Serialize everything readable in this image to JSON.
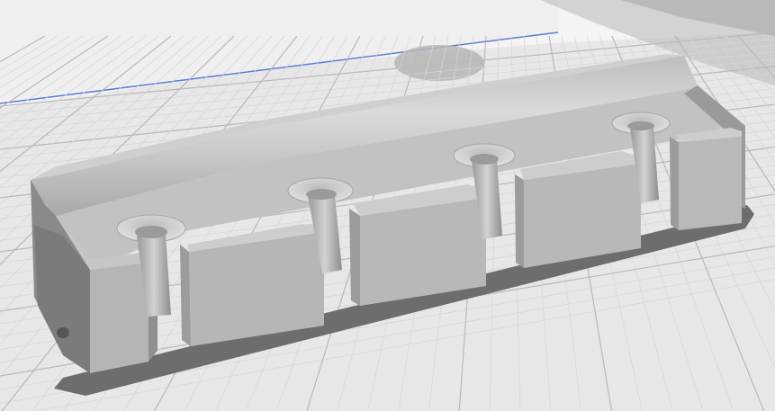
{
  "viewport": {
    "name": "3d-print-preview",
    "model": "bracket-with-countersunk-holes",
    "countersunk_hole_count": 4
  },
  "colors": {
    "background": "#f4f4f4",
    "bed_surface": "#e6e6e6",
    "grid_major": "#b9b9b9",
    "grid_minor": "#d6d6d6",
    "shadow": "#676767",
    "model_face_top": "#c4c4c4",
    "model_face_front": "#b3b3b3",
    "model_face_side": "#8f8f8f",
    "model_face_dark": "#7c7c7c",
    "build_volume_edge": "#5a7dd6"
  }
}
